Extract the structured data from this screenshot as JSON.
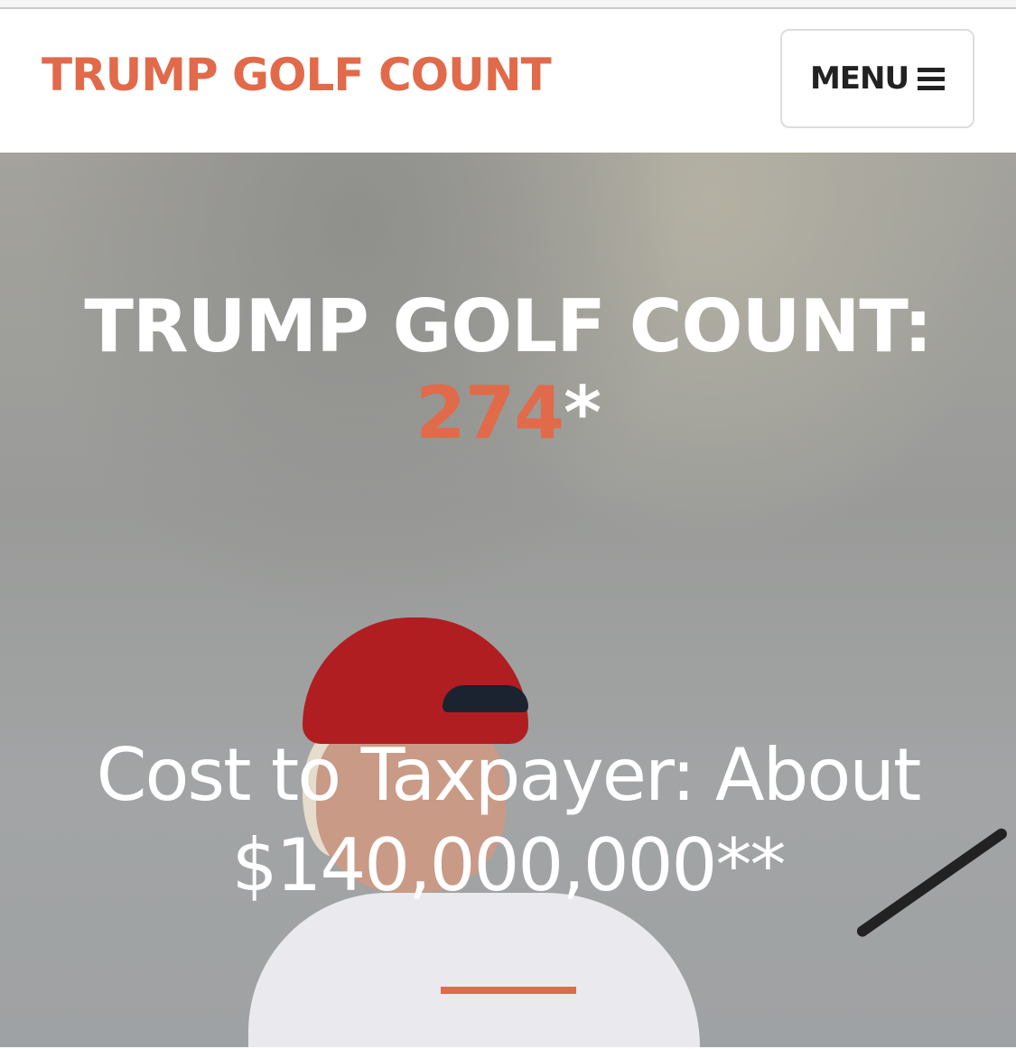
{
  "colors": {
    "accent": "#e16a4a"
  },
  "header": {
    "brand": "TRUMP GOLF COUNT",
    "menu_label": "MENU",
    "menu_icon": "hamburger-icon"
  },
  "hero": {
    "title": "TRUMP GOLF COUNT:",
    "count": "274",
    "count_suffix": "*",
    "cost_line1": "Cost to Taxpayer: About",
    "cost_line2": "$140,000,000**"
  }
}
